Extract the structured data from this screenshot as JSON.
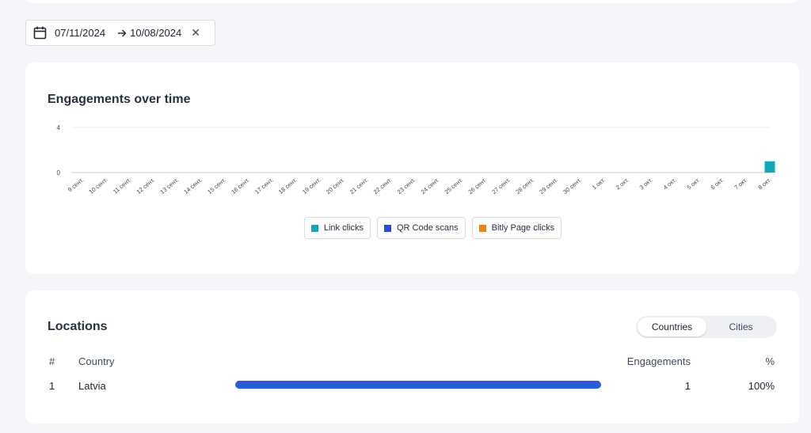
{
  "date_filter": {
    "start": "07/11/2024",
    "end": "10/08/2024"
  },
  "engagements_chart": {
    "title": "Engagements over time",
    "legend": [
      {
        "label": "Link clicks",
        "color": "#13a6b8"
      },
      {
        "label": "QR Code scans",
        "color": "#2a4fc8"
      },
      {
        "label": "Bitly Page clicks",
        "color": "#f0820f"
      }
    ]
  },
  "chart_data": {
    "type": "bar",
    "title": "Engagements over time",
    "xlabel": "",
    "ylabel": "",
    "ylim": [
      0,
      4
    ],
    "y_ticks": [
      "0",
      "4"
    ],
    "grid": true,
    "legend_position": "bottom",
    "categories": [
      "9 сент.",
      "10 сент.",
      "11 сент.",
      "12 сент.",
      "13 сент.",
      "14 сент.",
      "15 сент.",
      "16 сент.",
      "17 сент.",
      "18 сент.",
      "19 сент.",
      "20 сент.",
      "21 сент.",
      "22 сент.",
      "23 сент.",
      "24 сент.",
      "25 сент.",
      "26 сент.",
      "27 сент.",
      "28 сент.",
      "29 сент.",
      "30 сент.",
      "1 окт.",
      "2 окт.",
      "3 окт.",
      "4 окт.",
      "5 окт.",
      "6 окт.",
      "7 окт.",
      "8 окт."
    ],
    "series": [
      {
        "name": "Link clicks",
        "color": "#13a6b8",
        "values": [
          0,
          0,
          0,
          0,
          0,
          0,
          0,
          0,
          0,
          0,
          0,
          0,
          0,
          0,
          0,
          0,
          0,
          0,
          0,
          0,
          0,
          0,
          0,
          0,
          0,
          0,
          0,
          0,
          0,
          1
        ]
      },
      {
        "name": "QR Code scans",
        "color": "#2a4fc8",
        "values": [
          0,
          0,
          0,
          0,
          0,
          0,
          0,
          0,
          0,
          0,
          0,
          0,
          0,
          0,
          0,
          0,
          0,
          0,
          0,
          0,
          0,
          0,
          0,
          0,
          0,
          0,
          0,
          0,
          0,
          0
        ]
      },
      {
        "name": "Bitly Page clicks",
        "color": "#f0820f",
        "values": [
          0,
          0,
          0,
          0,
          0,
          0,
          0,
          0,
          0,
          0,
          0,
          0,
          0,
          0,
          0,
          0,
          0,
          0,
          0,
          0,
          0,
          0,
          0,
          0,
          0,
          0,
          0,
          0,
          0,
          0
        ]
      }
    ]
  },
  "locations": {
    "title": "Locations",
    "toggle": {
      "countries": "Countries",
      "cities": "Cities",
      "active": "countries"
    },
    "columns": {
      "num": "#",
      "country": "Country",
      "engagements": "Engagements",
      "percent": "%"
    },
    "rows": [
      {
        "num": "1",
        "country": "Latvia",
        "engagements": "1",
        "percent": "100%",
        "share": 1.0,
        "bar_color": "#2a5bd7"
      }
    ]
  }
}
